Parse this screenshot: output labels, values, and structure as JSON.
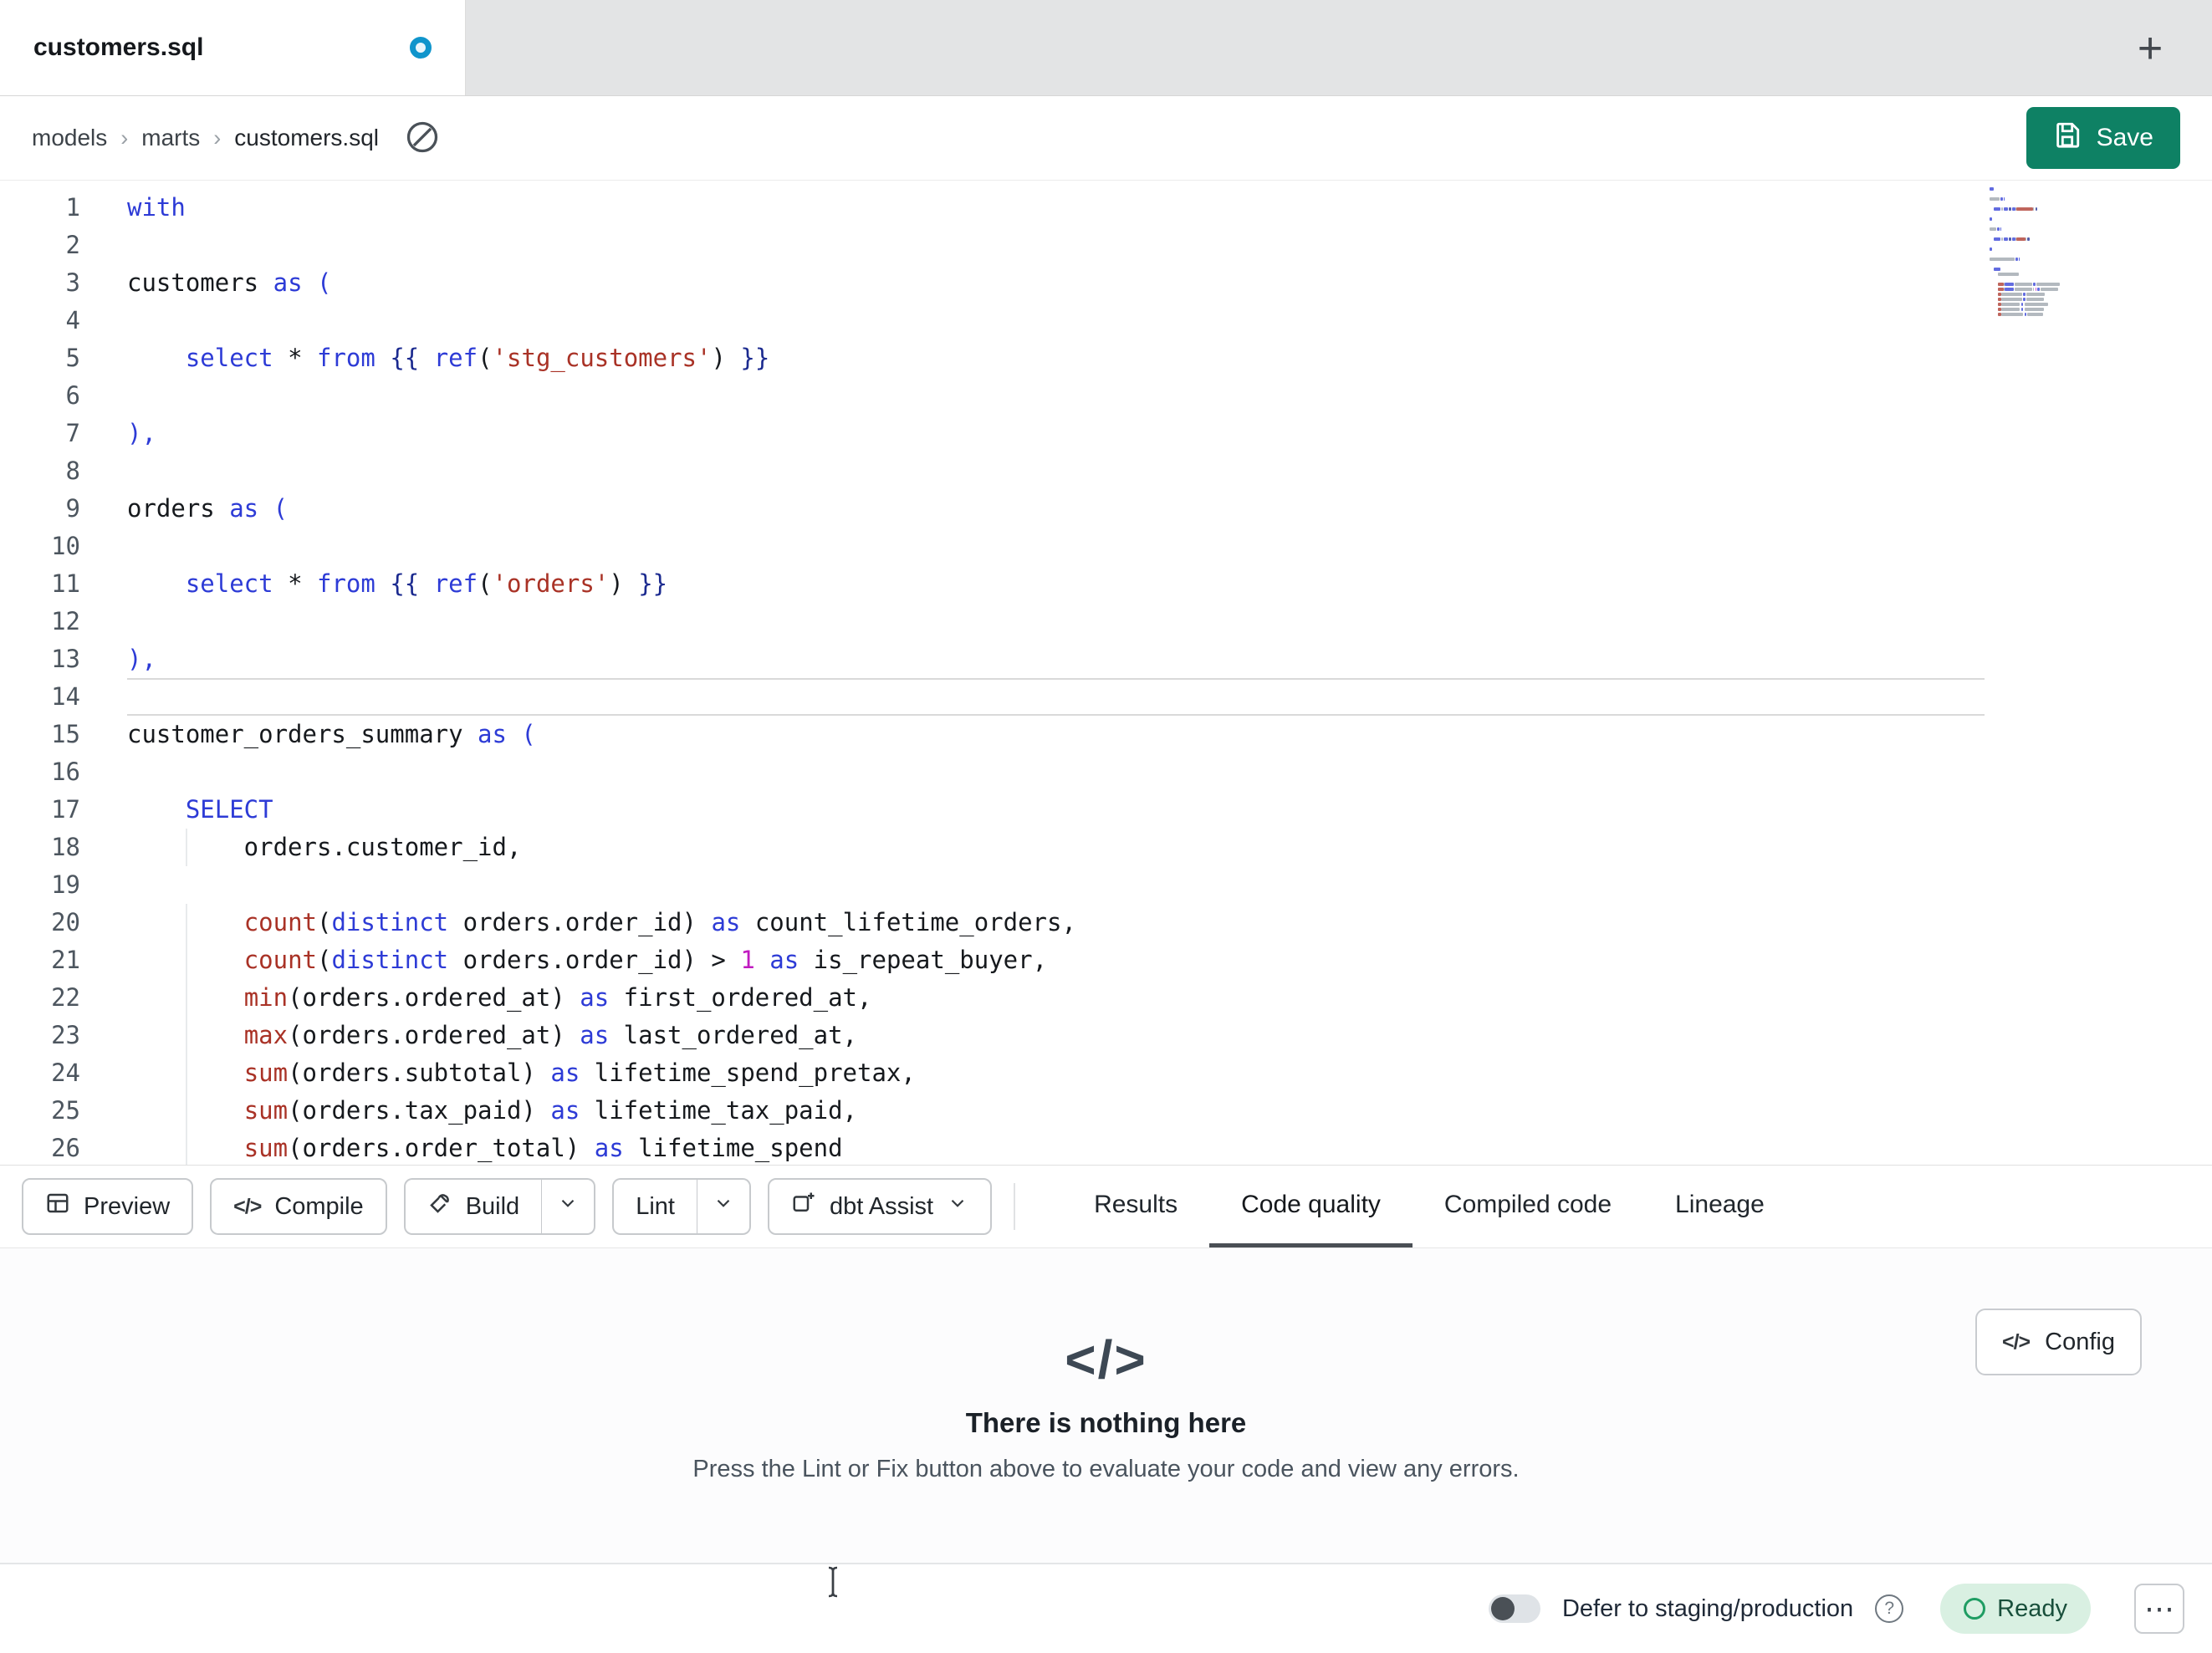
{
  "colors": {
    "save_button": "#0e8164",
    "unsaved_dot": "#1095cc",
    "ready_bg": "#d9f0e2",
    "ready_ring": "#1f9d63",
    "ready_text": "#184f3b",
    "active_tab_underline": "#4a4f55",
    "syntax": {
      "kw": "#2d3bd6",
      "fn": "#a93226",
      "str": "#a93226",
      "num": "#c01bc0",
      "jinja": "#1b2a8f",
      "brk": "#2d3bd6",
      "op": "#16191d",
      "pln": "#16191d"
    }
  },
  "tab_bar": {
    "active_tab": "customers.sql",
    "unsaved": true,
    "add_tab_glyph": "+"
  },
  "breadcrumb": {
    "items": [
      "models",
      "marts",
      "customers.sql"
    ],
    "separator": "›"
  },
  "actions": {
    "save_label": "Save"
  },
  "editor": {
    "active_line": 14,
    "lines": [
      {
        "n": 1,
        "t": [
          [
            "kw",
            "with"
          ]
        ]
      },
      {
        "n": 2,
        "t": []
      },
      {
        "n": 3,
        "t": [
          [
            "pln",
            "customers "
          ],
          [
            "kw",
            "as"
          ],
          [
            "pln",
            " "
          ],
          [
            "brk",
            "("
          ]
        ]
      },
      {
        "n": 4,
        "t": []
      },
      {
        "n": 5,
        "t": [
          [
            "pln",
            "    "
          ],
          [
            "kw",
            "select"
          ],
          [
            "pln",
            " "
          ],
          [
            "op",
            "*"
          ],
          [
            "pln",
            " "
          ],
          [
            "kw",
            "from"
          ],
          [
            "pln",
            " "
          ],
          [
            "jinja",
            "{{"
          ],
          [
            "pln",
            " "
          ],
          [
            "kw",
            "ref"
          ],
          [
            "pln",
            "("
          ],
          [
            "str",
            "'stg_customers'"
          ],
          [
            "pln",
            ") "
          ],
          [
            "jinja",
            "}}"
          ]
        ]
      },
      {
        "n": 6,
        "t": []
      },
      {
        "n": 7,
        "t": [
          [
            "brk",
            "),"
          ]
        ]
      },
      {
        "n": 8,
        "t": []
      },
      {
        "n": 9,
        "t": [
          [
            "pln",
            "orders "
          ],
          [
            "kw",
            "as"
          ],
          [
            "pln",
            " "
          ],
          [
            "brk",
            "("
          ]
        ]
      },
      {
        "n": 10,
        "t": []
      },
      {
        "n": 11,
        "t": [
          [
            "pln",
            "    "
          ],
          [
            "kw",
            "select"
          ],
          [
            "pln",
            " "
          ],
          [
            "op",
            "*"
          ],
          [
            "pln",
            " "
          ],
          [
            "kw",
            "from"
          ],
          [
            "pln",
            " "
          ],
          [
            "jinja",
            "{{"
          ],
          [
            "pln",
            " "
          ],
          [
            "kw",
            "ref"
          ],
          [
            "pln",
            "("
          ],
          [
            "str",
            "'orders'"
          ],
          [
            "pln",
            ") "
          ],
          [
            "jinja",
            "}}"
          ]
        ]
      },
      {
        "n": 12,
        "t": []
      },
      {
        "n": 13,
        "t": [
          [
            "brk",
            "),"
          ]
        ]
      },
      {
        "n": 14,
        "t": [],
        "active": true
      },
      {
        "n": 15,
        "t": [
          [
            "pln",
            "customer_orders_summary "
          ],
          [
            "kw",
            "as"
          ],
          [
            "pln",
            " "
          ],
          [
            "brk",
            "("
          ]
        ]
      },
      {
        "n": 16,
        "t": []
      },
      {
        "n": 17,
        "t": [
          [
            "pln",
            "    "
          ],
          [
            "kw",
            "SELECT"
          ]
        ]
      },
      {
        "n": 18,
        "t": [
          [
            "pln",
            "        orders.customer_id,"
          ]
        ]
      },
      {
        "n": 19,
        "t": []
      },
      {
        "n": 20,
        "t": [
          [
            "pln",
            "        "
          ],
          [
            "fn",
            "count"
          ],
          [
            "pln",
            "("
          ],
          [
            "kw",
            "distinct"
          ],
          [
            "pln",
            " orders.order_id) "
          ],
          [
            "kw",
            "as"
          ],
          [
            "pln",
            " count_lifetime_orders,"
          ]
        ]
      },
      {
        "n": 21,
        "t": [
          [
            "pln",
            "        "
          ],
          [
            "fn",
            "count"
          ],
          [
            "pln",
            "("
          ],
          [
            "kw",
            "distinct"
          ],
          [
            "pln",
            " orders.order_id) > "
          ],
          [
            "num",
            "1"
          ],
          [
            "pln",
            " "
          ],
          [
            "kw",
            "as"
          ],
          [
            "pln",
            " is_repeat_buyer,"
          ]
        ]
      },
      {
        "n": 22,
        "t": [
          [
            "pln",
            "        "
          ],
          [
            "fn",
            "min"
          ],
          [
            "pln",
            "(orders.ordered_at) "
          ],
          [
            "kw",
            "as"
          ],
          [
            "pln",
            " first_ordered_at,"
          ]
        ]
      },
      {
        "n": 23,
        "t": [
          [
            "pln",
            "        "
          ],
          [
            "fn",
            "max"
          ],
          [
            "pln",
            "(orders.ordered_at) "
          ],
          [
            "kw",
            "as"
          ],
          [
            "pln",
            " last_ordered_at,"
          ]
        ]
      },
      {
        "n": 24,
        "t": [
          [
            "pln",
            "        "
          ],
          [
            "fn",
            "sum"
          ],
          [
            "pln",
            "(orders.subtotal) "
          ],
          [
            "kw",
            "as"
          ],
          [
            "pln",
            " lifetime_spend_pretax,"
          ]
        ]
      },
      {
        "n": 25,
        "t": [
          [
            "pln",
            "        "
          ],
          [
            "fn",
            "sum"
          ],
          [
            "pln",
            "(orders.tax_paid) "
          ],
          [
            "kw",
            "as"
          ],
          [
            "pln",
            " lifetime_tax_paid,"
          ]
        ]
      },
      {
        "n": 26,
        "t": [
          [
            "pln",
            "        "
          ],
          [
            "fn",
            "sum"
          ],
          [
            "pln",
            "(orders.order_total) "
          ],
          [
            "kw",
            "as"
          ],
          [
            "pln",
            " lifetime_spend"
          ]
        ]
      }
    ]
  },
  "toolbar": {
    "preview": "Preview",
    "compile": "Compile",
    "compile_glyph": "</>",
    "build": "Build",
    "lint": "Lint",
    "dbt_assist": "dbt Assist"
  },
  "panel_tabs": [
    {
      "label": "Results",
      "active": false
    },
    {
      "label": "Code quality",
      "active": true
    },
    {
      "label": "Compiled code",
      "active": false
    },
    {
      "label": "Lineage",
      "active": false
    }
  ],
  "empty_state": {
    "glyph": "</>",
    "title": "There is nothing here",
    "message": "Press the Lint or Fix button above to evaluate your code and view any errors.",
    "config_label": "Config",
    "config_glyph": "</>"
  },
  "status_bar": {
    "toggle_on": false,
    "defer_label": "Defer to staging/production",
    "help_glyph": "?",
    "ready_label": "Ready",
    "more_glyph": "⋯"
  }
}
